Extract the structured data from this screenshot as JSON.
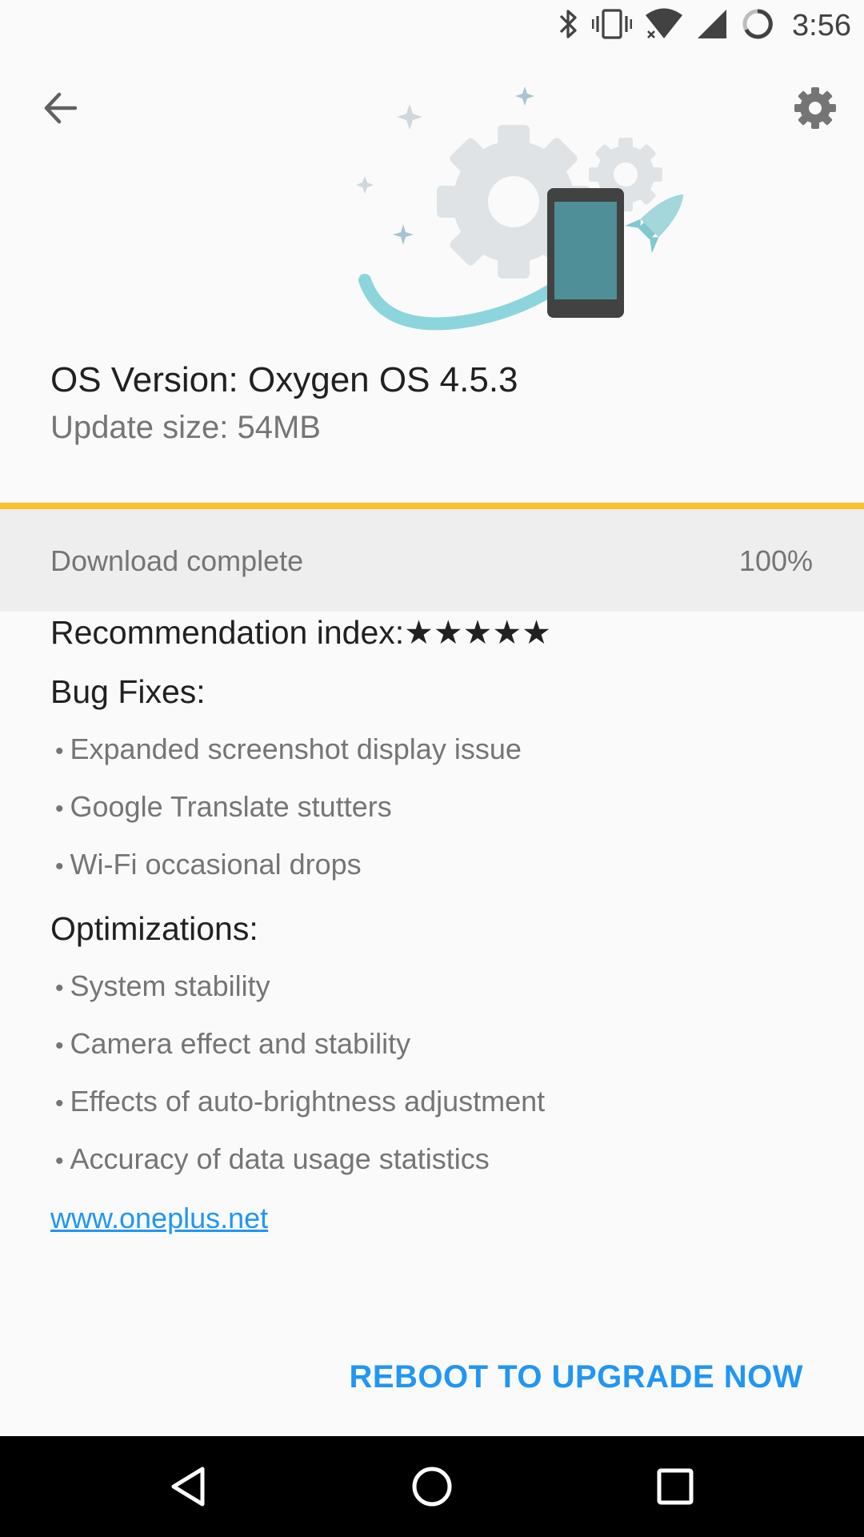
{
  "status_bar": {
    "time": "3:56",
    "icons": [
      "bluetooth-icon",
      "vibrate-icon",
      "wifi-icon",
      "cell-signal-icon",
      "battery-icon"
    ]
  },
  "toolbar": {
    "back_icon": "arrow-left-icon",
    "settings_icon": "gear-icon"
  },
  "update": {
    "os_version": "OS Version: Oxygen OS 4.5.3",
    "update_size": "Update size: 54MB"
  },
  "download": {
    "status": "Download complete",
    "percent_text": "100%",
    "progress": 1.0,
    "progress_color": "#fbc02d"
  },
  "notes": {
    "recommendation": "Recommendation index:★★★★★",
    "bug_fixes_title": "Bug Fixes:",
    "bug_fixes": [
      "Expanded screenshot display issue",
      "Google Translate stutters",
      "Wi-Fi occasional drops"
    ],
    "optimizations_title": "Optimizations:",
    "optimizations": [
      "System stability",
      "Camera effect and stability",
      "Effects of auto-brightness adjustment",
      "Accuracy of data usage statistics"
    ],
    "bullet": "•",
    "link": "www.oneplus.net"
  },
  "actions": {
    "reboot_label": "REBOOT TO UPGRADE NOW"
  },
  "colors": {
    "accent": "#2196f3",
    "progress": "#fbc02d",
    "background": "#fafafa"
  }
}
